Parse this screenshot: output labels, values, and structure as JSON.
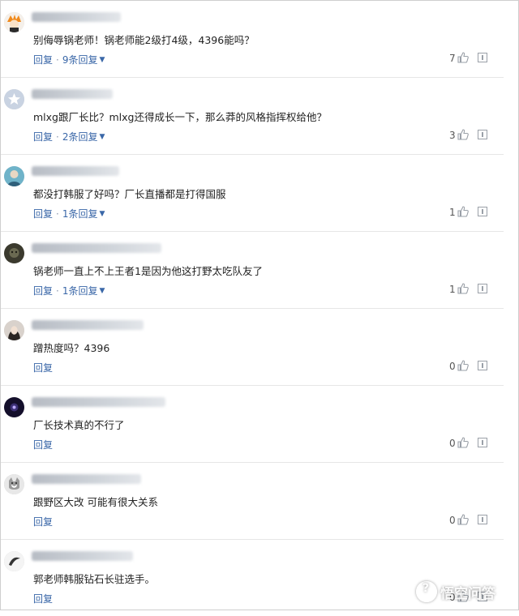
{
  "comments": [
    {
      "text": "别侮辱锅老师！锅老师能2级打4级，4396能吗？",
      "reply_label": "回复",
      "replies_label": "9条回复",
      "likes": "7"
    },
    {
      "text": "mlxg跟厂长比？mlxg还得成长一下，那么莽的风格指挥权给他？",
      "reply_label": "回复",
      "replies_label": "2条回复",
      "likes": "3"
    },
    {
      "text": "都没打韩服了好吗？厂长直播都是打得国服",
      "reply_label": "回复",
      "replies_label": "1条回复",
      "likes": "1"
    },
    {
      "text": "锅老师一直上不上王者1是因为他这打野太吃队友了",
      "reply_label": "回复",
      "replies_label": "1条回复",
      "likes": "1"
    },
    {
      "text": "蹭热度吗？4396",
      "reply_label": "回复",
      "likes": "0"
    },
    {
      "text": "厂长技术真的不行了",
      "reply_label": "回复",
      "likes": "0"
    },
    {
      "text": "跟野区大改 可能有很大关系",
      "reply_label": "回复",
      "likes": "0"
    },
    {
      "text": "郭老师韩服钻石长驻选手。",
      "reply_label": "回复",
      "likes": "0"
    }
  ],
  "watermark": {
    "label": "悟空问答",
    "icon": "wukong-logo-icon"
  },
  "colors": {
    "link": "#3a67a8",
    "divider": "#e6e6e6"
  }
}
